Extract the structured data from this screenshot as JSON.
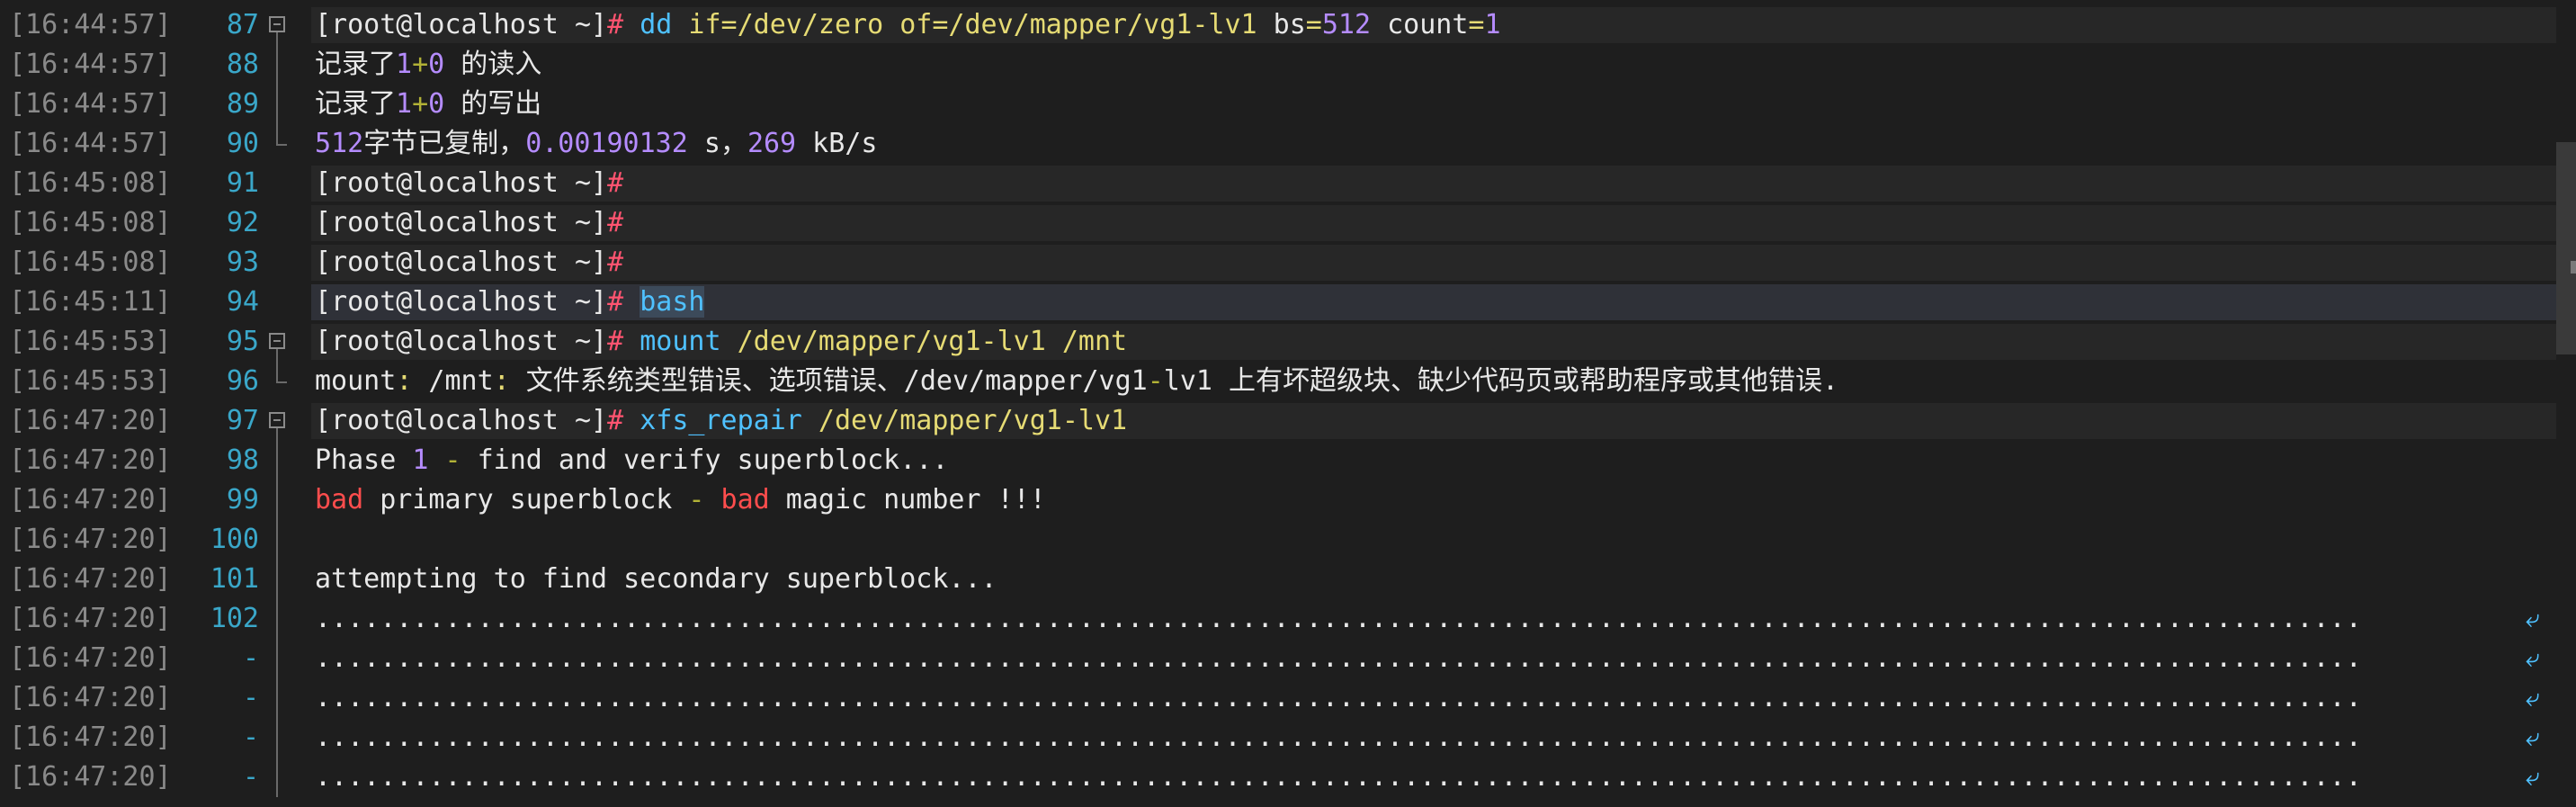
{
  "colors": {
    "background": "#1e1e1e",
    "timestamp": "#8a8a8a",
    "line_number": "#3aa7c9",
    "prompt_hash": "#ff5470",
    "command": "#4fc1ff",
    "path": "#e6db74",
    "number": "#b58cff",
    "error_word": "#ff4d4d"
  },
  "lines": [
    {
      "ts": "[16:44:57]",
      "ln": "87",
      "fold": "start",
      "hl": "hl",
      "segs": [
        {
          "t": "[root@localhost ~]",
          "c": "prompt"
        },
        {
          "t": "# ",
          "c": "hash"
        },
        {
          "t": "dd ",
          "c": "cmd"
        },
        {
          "t": "if=/dev/zero of=/dev/mapper/vg1-lv1 ",
          "c": "path"
        },
        {
          "t": "bs",
          "c": "plain"
        },
        {
          "t": "=",
          "c": "path"
        },
        {
          "t": "512",
          "c": "num"
        },
        {
          "t": " count",
          "c": "plain"
        },
        {
          "t": "=",
          "c": "path"
        },
        {
          "t": "1",
          "c": "num"
        }
      ]
    },
    {
      "ts": "[16:44:57]",
      "ln": "88",
      "fold": "mid",
      "hl": "",
      "segs": [
        {
          "t": "记录了",
          "c": "plain"
        },
        {
          "t": "1",
          "c": "num"
        },
        {
          "t": "+",
          "c": "op"
        },
        {
          "t": "0",
          "c": "num"
        },
        {
          "t": " 的读入",
          "c": "plain"
        }
      ]
    },
    {
      "ts": "[16:44:57]",
      "ln": "89",
      "fold": "mid",
      "hl": "",
      "segs": [
        {
          "t": "记录了",
          "c": "plain"
        },
        {
          "t": "1",
          "c": "num"
        },
        {
          "t": "+",
          "c": "op"
        },
        {
          "t": "0",
          "c": "num"
        },
        {
          "t": " 的写出",
          "c": "plain"
        }
      ]
    },
    {
      "ts": "[16:44:57]",
      "ln": "90",
      "fold": "end",
      "hl": "",
      "segs": [
        {
          "t": "512",
          "c": "num"
        },
        {
          "t": "字节已复制，",
          "c": "plain"
        },
        {
          "t": "0.00190132",
          "c": "num"
        },
        {
          "t": " s，",
          "c": "plain"
        },
        {
          "t": "269",
          "c": "num"
        },
        {
          "t": " kB/s",
          "c": "plain"
        }
      ]
    },
    {
      "ts": "[16:45:08]",
      "ln": "91",
      "fold": "",
      "hl": "hl",
      "segs": [
        {
          "t": "[root@localhost ~]",
          "c": "prompt"
        },
        {
          "t": "#",
          "c": "hash"
        }
      ]
    },
    {
      "ts": "[16:45:08]",
      "ln": "92",
      "fold": "",
      "hl": "hl",
      "segs": [
        {
          "t": "[root@localhost ~]",
          "c": "prompt"
        },
        {
          "t": "#",
          "c": "hash"
        }
      ]
    },
    {
      "ts": "[16:45:08]",
      "ln": "93",
      "fold": "",
      "hl": "hl",
      "segs": [
        {
          "t": "[root@localhost ~]",
          "c": "prompt"
        },
        {
          "t": "#",
          "c": "hash"
        }
      ]
    },
    {
      "ts": "[16:45:11]",
      "ln": "94",
      "fold": "",
      "hl": "hl-strong",
      "segs": [
        {
          "t": "[root@localhost ~]",
          "c": "prompt"
        },
        {
          "t": "# ",
          "c": "hash"
        },
        {
          "t": "bash",
          "c": "sel"
        }
      ]
    },
    {
      "ts": "[16:45:53]",
      "ln": "95",
      "fold": "start",
      "hl": "hl",
      "segs": [
        {
          "t": "[root@localhost ~]",
          "c": "prompt"
        },
        {
          "t": "# ",
          "c": "hash"
        },
        {
          "t": "mount ",
          "c": "cmd"
        },
        {
          "t": "/dev/mapper/vg1-lv1 /mnt",
          "c": "path"
        }
      ]
    },
    {
      "ts": "[16:45:53]",
      "ln": "96",
      "fold": "end",
      "hl": "",
      "segs": [
        {
          "t": "mount",
          "c": "plain"
        },
        {
          "t": ":",
          "c": "path"
        },
        {
          "t": " /mnt",
          "c": "plain"
        },
        {
          "t": ":",
          "c": "path"
        },
        {
          "t": " 文件系统类型错误、选项错误、/dev/mapper/vg1",
          "c": "plain"
        },
        {
          "t": "-",
          "c": "op"
        },
        {
          "t": "lv1 上有坏超级块、缺少代码页或帮助程序或其他错误.",
          "c": "plain"
        }
      ]
    },
    {
      "ts": "[16:47:20]",
      "ln": "97",
      "fold": "start",
      "hl": "hl",
      "segs": [
        {
          "t": "[root@localhost ~]",
          "c": "prompt"
        },
        {
          "t": "# ",
          "c": "hash"
        },
        {
          "t": "xfs_repair ",
          "c": "cmd"
        },
        {
          "t": "/dev/mapper/vg1-lv1",
          "c": "path"
        }
      ]
    },
    {
      "ts": "[16:47:20]",
      "ln": "98",
      "fold": "mid",
      "hl": "",
      "segs": [
        {
          "t": "Phase ",
          "c": "plain"
        },
        {
          "t": "1",
          "c": "num"
        },
        {
          "t": " - ",
          "c": "op"
        },
        {
          "t": "find and verify superblock...",
          "c": "plain"
        }
      ]
    },
    {
      "ts": "[16:47:20]",
      "ln": "99",
      "fold": "mid",
      "hl": "",
      "segs": [
        {
          "t": "bad",
          "c": "red"
        },
        {
          "t": " primary superblock ",
          "c": "plain"
        },
        {
          "t": "-",
          "c": "op"
        },
        {
          "t": " ",
          "c": "plain"
        },
        {
          "t": "bad",
          "c": "red"
        },
        {
          "t": " magic number !!!",
          "c": "plain"
        }
      ]
    },
    {
      "ts": "[16:47:20]",
      "ln": "100",
      "fold": "mid",
      "hl": "",
      "segs": []
    },
    {
      "ts": "[16:47:20]",
      "ln": "101",
      "fold": "mid",
      "hl": "",
      "segs": [
        {
          "t": "attempting to find secondary superblock...",
          "c": "plain"
        }
      ]
    },
    {
      "ts": "[16:47:20]",
      "ln": "102",
      "fold": "mid",
      "hl": "",
      "wrap": true,
      "segs": [
        {
          "t": "..............................................................................................................................",
          "c": "plain"
        }
      ]
    },
    {
      "ts": "[16:47:20]",
      "ln": "-",
      "fold": "mid",
      "hl": "",
      "wrap": true,
      "segs": [
        {
          "t": "..............................................................................................................................",
          "c": "plain"
        }
      ]
    },
    {
      "ts": "[16:47:20]",
      "ln": "-",
      "fold": "mid",
      "hl": "",
      "wrap": true,
      "segs": [
        {
          "t": "..............................................................................................................................",
          "c": "plain"
        }
      ]
    },
    {
      "ts": "[16:47:20]",
      "ln": "-",
      "fold": "mid",
      "hl": "",
      "wrap": true,
      "segs": [
        {
          "t": "..............................................................................................................................",
          "c": "plain"
        }
      ]
    },
    {
      "ts": "[16:47:20]",
      "ln": "-",
      "fold": "mid",
      "hl": "",
      "wrap": true,
      "segs": [
        {
          "t": "..............................................................................................................................",
          "c": "plain"
        }
      ]
    }
  ],
  "wrap_icon": "wrap-arrow-icon"
}
